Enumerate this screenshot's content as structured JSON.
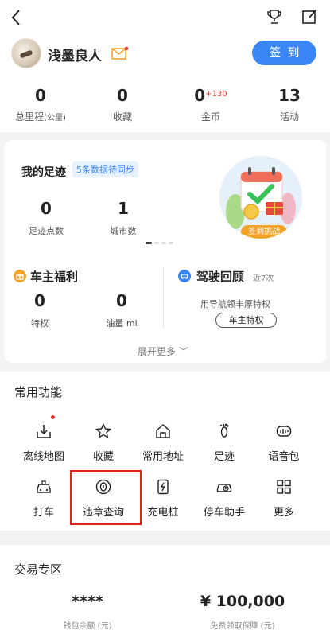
{
  "header": {
    "back_icon": "chevron-left-icon",
    "trophy_icon": "trophy-icon",
    "edit_icon": "edit-icon"
  },
  "profile": {
    "username": "浅墨良人",
    "sign_label": "签到",
    "stats": [
      {
        "value": "0",
        "label": "总里程",
        "unit": "(公里)"
      },
      {
        "value": "0",
        "label": "收藏"
      },
      {
        "value": "0",
        "extra": "+130",
        "label": "金币"
      },
      {
        "value": "13",
        "label": "活动"
      }
    ]
  },
  "footprint": {
    "title": "我的足迹",
    "badge": "5条数据待同步",
    "stats": [
      {
        "value": "0",
        "label": "足迹点数"
      },
      {
        "value": "1",
        "label": "城市数"
      }
    ],
    "challenge_label": "签到挑战"
  },
  "owner_benefits": {
    "title": "车主福利",
    "stats": [
      {
        "value": "0",
        "label": "特权"
      },
      {
        "value": "0",
        "label": "油量 ml"
      }
    ]
  },
  "driving_review": {
    "title": "驾驶回顾",
    "sub": "近7次",
    "text": "用导航领丰厚特权",
    "button": "车主特权"
  },
  "expand_more": "展开更多 ﹀",
  "common_functions": {
    "title": "常用功能",
    "items": [
      {
        "label": "离线地图",
        "icon": "offline-map-icon"
      },
      {
        "label": "收藏",
        "icon": "star-icon"
      },
      {
        "label": "常用地址",
        "icon": "home-address-icon"
      },
      {
        "label": "足迹",
        "icon": "footprint-icon"
      },
      {
        "label": "语音包",
        "icon": "voice-pack-icon"
      },
      {
        "label": "打车",
        "icon": "taxi-icon"
      },
      {
        "label": "违章查询",
        "icon": "violation-query-icon"
      },
      {
        "label": "充电桩",
        "icon": "charging-pile-icon"
      },
      {
        "label": "停车助手",
        "icon": "parking-assistant-icon"
      },
      {
        "label": "更多",
        "icon": "grid-more-icon"
      }
    ]
  },
  "trade_zone": {
    "title": "交易专区",
    "items": [
      {
        "value": "****",
        "label": "钱包余额 (元)"
      },
      {
        "value": "¥ 100,000",
        "label": "免费领取保障 (元)"
      }
    ]
  },
  "colors": {
    "accent": "#3b86f5",
    "highlight_border": "#e2231a",
    "coin_plus": "#e8473b"
  }
}
